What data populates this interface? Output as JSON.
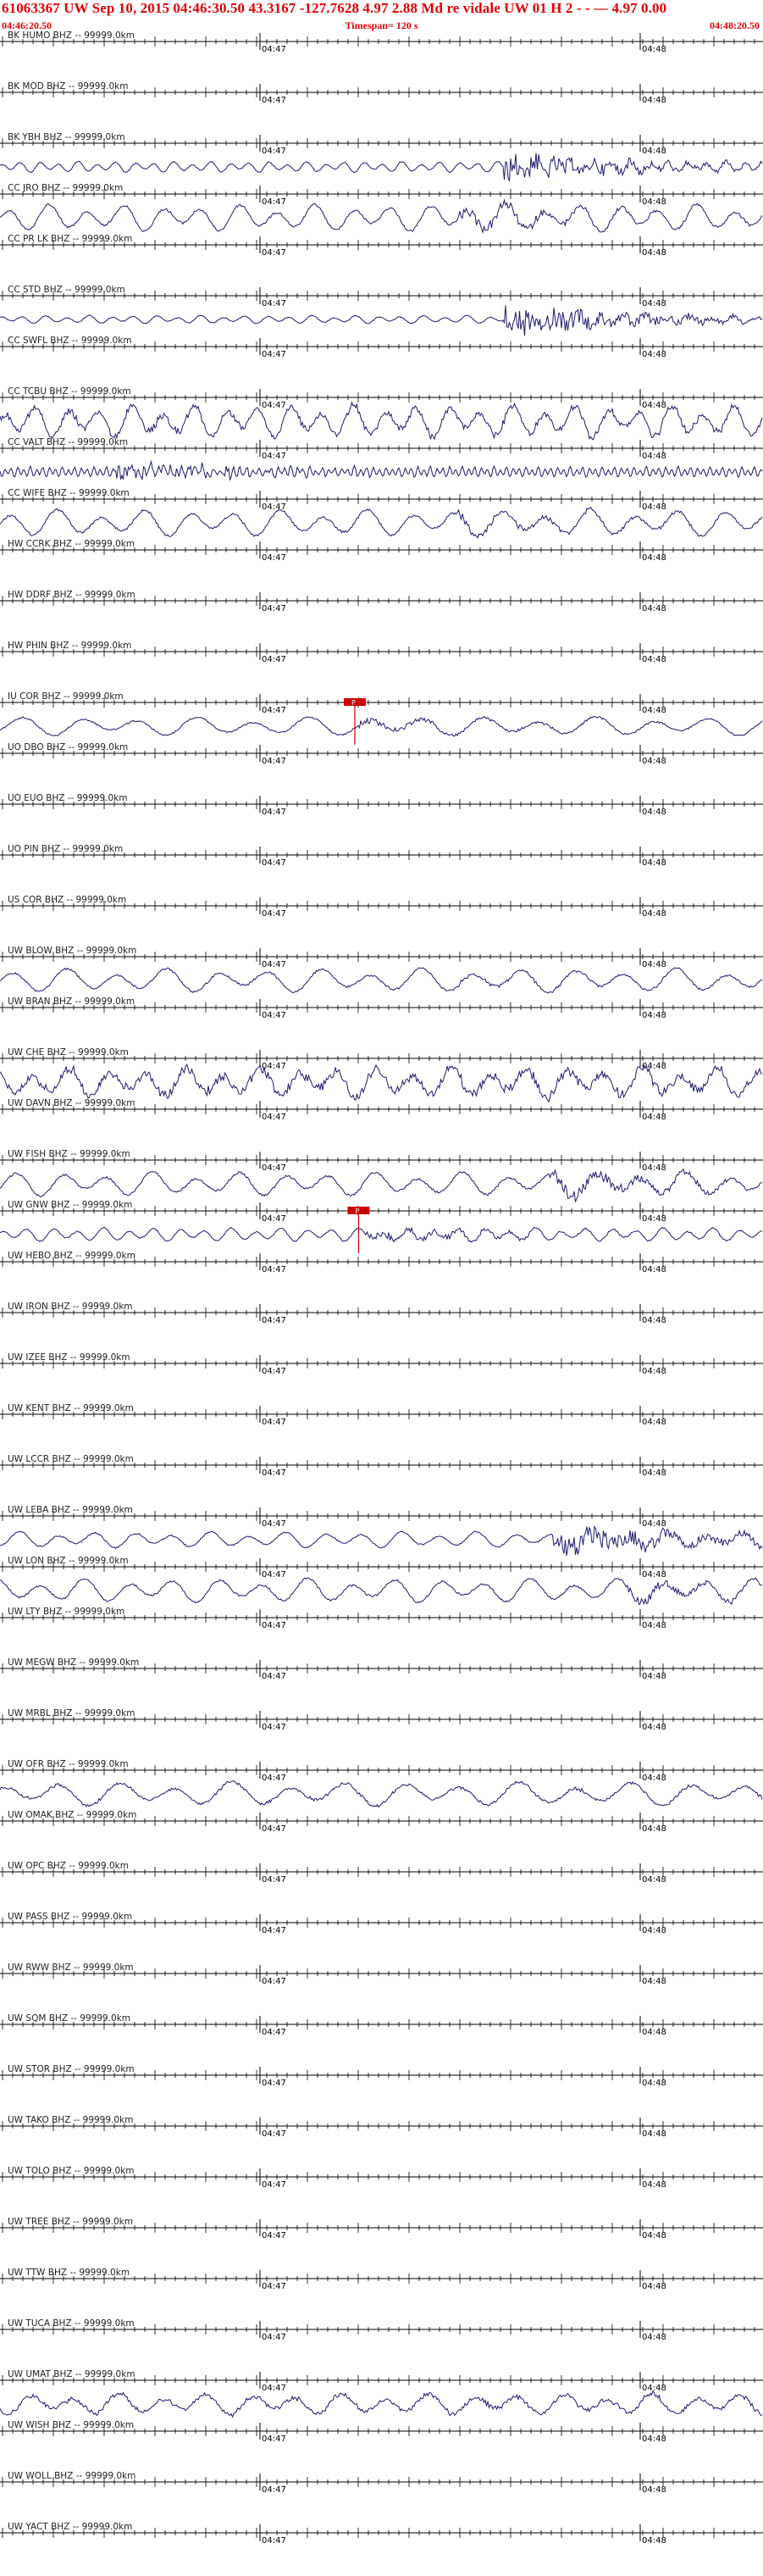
{
  "header": {
    "title": "61063367 UW Sep 10, 2015 04:46:30.50   43.3167 -127.7628  4.97 2.88 Md re    vidale   UW 01 H    2  - - —    4.97 0.00",
    "start_time": "04:46:20.50",
    "timespan": "Timespan= 120 s",
    "end_time": "04:48:20.50"
  },
  "colors": {
    "header_text": "#e00000",
    "trace": "#1a1a6e",
    "axis": "#000000",
    "pick": "#cc0000"
  },
  "time_labels": [
    "04:47",
    "04:48"
  ],
  "pick_label": "P",
  "chart_data": {
    "type": "line",
    "title": "61063367 UW Sep 10, 2015 04:46:30.50",
    "x_range_seconds": [
      0,
      120
    ],
    "x_tick_labels": [
      "04:47",
      "04:48"
    ],
    "channels": [
      {
        "label": "BK HUMO BHZ -- 99999.0km",
        "trace": false
      },
      {
        "label": "BK MOD BHZ -- 99999.0km",
        "trace": false
      },
      {
        "label": "BK YBH BHZ -- 99999.0km",
        "trace": true,
        "amp": 0.4,
        "period": 3,
        "burst_start": 0.66,
        "burst_amp": 1.4
      },
      {
        "label": "CC JRO BHZ -- 99999.0km",
        "trace": true,
        "amp": 1.0,
        "period": 6,
        "burst_start": 0.6,
        "burst_amp": 0.6
      },
      {
        "label": "CC PR LK BHZ -- 99999.0km",
        "trace": false
      },
      {
        "label": "CC STD BHZ -- 99999.0km",
        "trace": true,
        "amp": 0.3,
        "period": 3.5,
        "burst_start": 0.66,
        "burst_amp": 1.6
      },
      {
        "label": "CC SWFL BHZ -- 99999.0km",
        "trace": false
      },
      {
        "label": "CC TCBU BHZ -- 99999.0km",
        "trace": true,
        "amp": 1.2,
        "period": 5,
        "burst_start": 0,
        "burst_amp": 0.3
      },
      {
        "label": "CC VALT BHZ -- 99999.0km",
        "trace": true,
        "amp": 0.4,
        "period": 1,
        "burst_start": 0.15,
        "burst_amp": 0.9
      },
      {
        "label": "CC WIFE BHZ -- 99999.0km",
        "trace": true,
        "amp": 1.0,
        "period": 7,
        "burst_start": 0.6,
        "burst_amp": 0.4
      },
      {
        "label": "HW CCRK BHZ -- 99999.0km",
        "trace": false
      },
      {
        "label": "HW DDRF BHZ -- 99999.0km",
        "trace": false
      },
      {
        "label": "HW PHIN BHZ -- 99999.0km",
        "trace": false
      },
      {
        "label": "IU COR BHZ -- 99999.0km",
        "trace": true,
        "amp": 0.7,
        "period": 9,
        "burst_start": 0.47,
        "burst_amp": 0.3,
        "pick": 0.465
      },
      {
        "label": "UO DBO BHZ -- 99999.0km",
        "trace": false
      },
      {
        "label": "UO EUO BHZ -- 99999.0km",
        "trace": false
      },
      {
        "label": "UO PIN BHZ -- 99999.0km",
        "trace": false
      },
      {
        "label": "US COR BHZ -- 99999.0km",
        "trace": false
      },
      {
        "label": "UW BLOW BHZ -- 99999.0km",
        "trace": true,
        "amp": 0.9,
        "period": 8,
        "burst_start": 0.6,
        "burst_amp": 0.2
      },
      {
        "label": "UW BRAN BHZ -- 99999.0km",
        "trace": false
      },
      {
        "label": "UW CHE BHZ -- 99999.0km",
        "trace": true,
        "amp": 1.1,
        "period": 6,
        "burst_start": 0,
        "burst_amp": 0.45
      },
      {
        "label": "UW DAVN BHZ -- 99999.0km",
        "trace": false
      },
      {
        "label": "UW FISH BHZ -- 99999.0km",
        "trace": true,
        "amp": 0.9,
        "period": 7,
        "burst_start": 0.72,
        "burst_amp": 0.8
      },
      {
        "label": "UW GNW BHZ -- 99999.0km",
        "trace": true,
        "amp": 0.5,
        "period": 4,
        "burst_start": 0.48,
        "burst_amp": 0.6,
        "pick": 0.47
      },
      {
        "label": "UW HEBO BHZ -- 99999.0km",
        "trace": false
      },
      {
        "label": "UW IRON BHZ -- 99999.0km",
        "trace": false
      },
      {
        "label": "UW IZEE BHZ -- 99999.0km",
        "trace": false
      },
      {
        "label": "UW KENT BHZ -- 99999.0km",
        "trace": false
      },
      {
        "label": "UW LCCR BHZ -- 99999.0km",
        "trace": false
      },
      {
        "label": "UW LEBA BHZ -- 99999.0km",
        "trace": true,
        "amp": 0.6,
        "period": 6,
        "burst_start": 0.72,
        "burst_amp": 1.5
      },
      {
        "label": "UW LON BHZ -- 99999.0km",
        "trace": true,
        "amp": 0.9,
        "period": 7,
        "burst_start": 0.82,
        "burst_amp": 0.5
      },
      {
        "label": "UW LTY BHZ -- 99999.0km",
        "trace": false
      },
      {
        "label": "UW MEGW BHZ -- 99999.0km",
        "trace": false
      },
      {
        "label": "UW MRBL BHZ -- 99999.0km",
        "trace": false
      },
      {
        "label": "UW OFR BHZ -- 99999.0km",
        "trace": true,
        "amp": 0.9,
        "period": 9,
        "burst_start": 0,
        "burst_amp": 0.1
      },
      {
        "label": "UW OMAK BHZ -- 99999.0km",
        "trace": false
      },
      {
        "label": "UW OPC BHZ -- 99999.0km",
        "trace": false
      },
      {
        "label": "UW PASS BHZ -- 99999.0km",
        "trace": false
      },
      {
        "label": "UW RWW BHZ -- 99999.0km",
        "trace": false
      },
      {
        "label": "UW SQM BHZ -- 99999.0km",
        "trace": false
      },
      {
        "label": "UW STOR BHZ -- 99999.0km",
        "trace": false
      },
      {
        "label": "UW TAKO BHZ -- 99999.0km",
        "trace": false
      },
      {
        "label": "UW TOLO BHZ -- 99999.0km",
        "trace": false
      },
      {
        "label": "UW TREE BHZ -- 99999.0km",
        "trace": false
      },
      {
        "label": "UW TTW BHZ -- 99999.0km",
        "trace": false
      },
      {
        "label": "UW TUCA BHZ -- 99999.0km",
        "trace": false
      },
      {
        "label": "UW UMAT BHZ -- 99999.0km",
        "trace": true,
        "amp": 0.8,
        "period": 7,
        "burst_start": 0,
        "burst_amp": 0.2
      },
      {
        "label": "UW WISH BHZ -- 99999.0km",
        "trace": false
      },
      {
        "label": "UW WOLL BHZ -- 99999.0km",
        "trace": false
      },
      {
        "label": "UW YACT BHZ -- 99999.0km",
        "trace": false
      }
    ]
  }
}
